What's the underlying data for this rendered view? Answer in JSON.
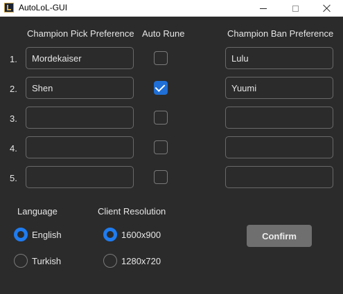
{
  "window": {
    "title": "AutoLoL-GUI"
  },
  "headers": {
    "pick": "Champion Pick Preference",
    "rune": "Auto Rune",
    "ban": "Champion Ban Preference"
  },
  "rows": [
    {
      "num": "1.",
      "pick": "Mordekaiser",
      "ban": "Lulu",
      "auto_rune": false
    },
    {
      "num": "2.",
      "pick": "Shen",
      "ban": "Yuumi",
      "auto_rune": true
    },
    {
      "num": "3.",
      "pick": "",
      "ban": "",
      "auto_rune": false
    },
    {
      "num": "4.",
      "pick": "",
      "ban": "",
      "auto_rune": false
    },
    {
      "num": "5.",
      "pick": "",
      "ban": "",
      "auto_rune": false
    }
  ],
  "language": {
    "label": "Language",
    "options": [
      "English",
      "Turkish"
    ],
    "selected": "English"
  },
  "resolution": {
    "label": "Client Resolution",
    "options": [
      "1600x900",
      "1280x720"
    ],
    "selected": "1600x900"
  },
  "confirm_label": "Confirm",
  "colors": {
    "accent": "#1f7cf0",
    "background": "#2b2b2b",
    "button": "#6f6f6f"
  }
}
